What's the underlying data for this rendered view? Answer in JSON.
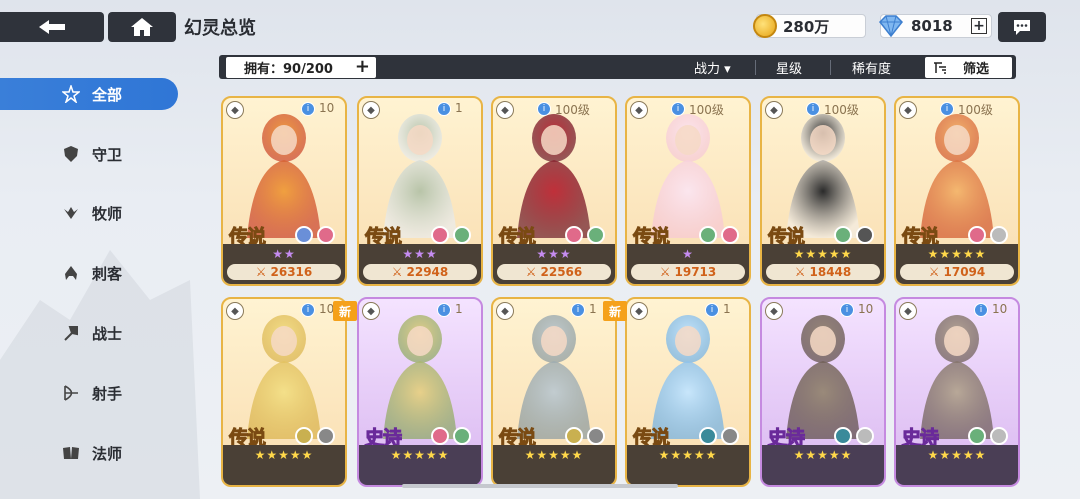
{
  "header": {
    "title": "幻灵总览",
    "gold": "280万",
    "gems": "8018",
    "plus": "+"
  },
  "sidebar": {
    "items": [
      {
        "label": "全部",
        "icon": "star-outline-icon",
        "active": true
      },
      {
        "label": "守卫",
        "icon": "shield-icon"
      },
      {
        "label": "牧师",
        "icon": "wings-icon"
      },
      {
        "label": "刺客",
        "icon": "hood-icon"
      },
      {
        "label": "战士",
        "icon": "axe-icon"
      },
      {
        "label": "射手",
        "icon": "bow-icon"
      },
      {
        "label": "法师",
        "icon": "book-icon"
      }
    ]
  },
  "toolbar": {
    "owned_label": "拥有：90/200",
    "sort_power": "战力 ▾",
    "sort_star": "星级",
    "sort_rarity": "稀有度",
    "filter_label": "筛选"
  },
  "cards": [
    {
      "rarity": "传说",
      "level": "10",
      "stars": "★★",
      "star_color": "purple",
      "power": "26316",
      "class": "bow",
      "tier": "legend"
    },
    {
      "rarity": "传说",
      "level": "1",
      "stars": "★★★",
      "star_color": "purple",
      "power": "22948",
      "class": "shield",
      "tier": "legend"
    },
    {
      "rarity": "传说",
      "level": "100级",
      "stars": "★★★",
      "star_color": "purple",
      "power": "22566",
      "class": "axe",
      "tier": "legend"
    },
    {
      "rarity": "传说",
      "level": "100级",
      "stars": "★",
      "star_color": "purple",
      "power": "19713",
      "class": "wings",
      "tier": "legend"
    },
    {
      "rarity": "传说",
      "level": "100级",
      "stars": "★★★★★",
      "star_color": "gold",
      "power": "18448",
      "class": "hood",
      "tier": "legend"
    },
    {
      "rarity": "传说",
      "level": "100级",
      "stars": "★★★★★",
      "star_color": "gold",
      "power": "17094",
      "class": "book",
      "tier": "legend"
    },
    {
      "rarity": "传说",
      "level": "10",
      "stars": "★★★★★",
      "star_color": "gold",
      "power": "",
      "class": "bow",
      "tier": "legend",
      "new": "新"
    },
    {
      "rarity": "史诗",
      "level": "1",
      "stars": "★★★★★",
      "star_color": "gold",
      "power": "",
      "class": "shield",
      "tier": "epic"
    },
    {
      "rarity": "传说",
      "level": "1",
      "stars": "★★★★★",
      "star_color": "gold",
      "power": "",
      "class": "shield",
      "tier": "legend",
      "new": "新"
    },
    {
      "rarity": "传说",
      "level": "1",
      "stars": "★★★★★",
      "star_color": "gold",
      "power": "",
      "class": "shield",
      "tier": "legend"
    },
    {
      "rarity": "史诗",
      "level": "10",
      "stars": "★★★★★",
      "star_color": "gold",
      "power": "",
      "class": "bow",
      "tier": "epic"
    },
    {
      "rarity": "史诗",
      "level": "10",
      "stars": "★★★★★",
      "star_color": "gold",
      "power": "",
      "class": "bow",
      "tier": "epic"
    }
  ],
  "colors": {
    "accent": "#2f76d6",
    "dark_panel": "#2f333b",
    "legend_border": "#e8b445",
    "epic_border": "#c58ae0",
    "power_text": "#d0621a"
  }
}
